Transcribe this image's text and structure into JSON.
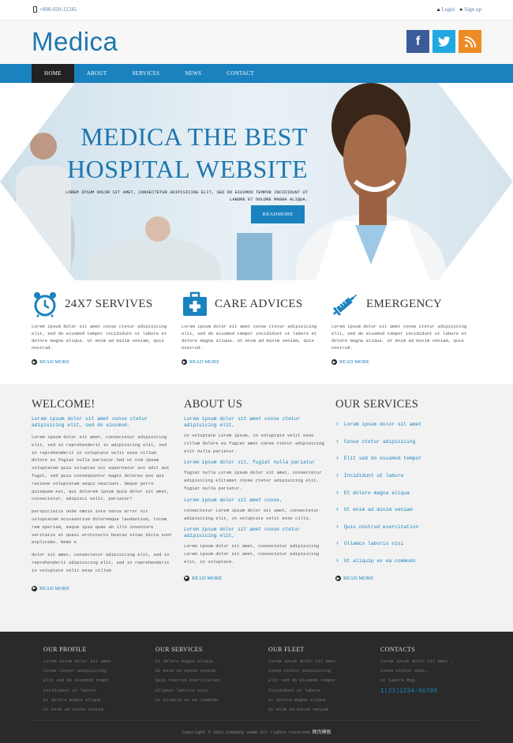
{
  "topbar": {
    "phone": "+800-020-12345",
    "login": "Login",
    "signup": "Sign up"
  },
  "header": {
    "logo": "Medica"
  },
  "social": {
    "facebook": "f",
    "twitter": "t",
    "rss": "rss"
  },
  "nav": {
    "items": [
      "HOME",
      "ABOUT",
      "SERVICES",
      "NEWS",
      "CONTACT"
    ]
  },
  "hero": {
    "title_line1": "MEDICA THE BEST",
    "title_line2": "HOSPITAL WEBSITE",
    "subtitle": "LOREM IPSUM DOLOR SIT AMET, CONSECTETUR ADIPISICING ELIT, SED DO EIUSMOD TEMPOR INCIDIDUNT UT LABORE ET DOLORE MAGNA ALIQUA.",
    "button": "READMORE"
  },
  "features": [
    {
      "title": "24X7 SERVIVES",
      "text": "Lorem ipsum dolor sit amet conse ctetur adipisicing elit, sed do eiusmod tempor incididunt ut labore et dolore magna aliqua. Ut enim ad minim veniam, quis nostrud.",
      "readmore": "READ MORE"
    },
    {
      "title": "CARE ADVICES",
      "text": "Lorem ipsum dolor sit amet conse ctetur adipisicing elit, sed do eiusmod tempor incididunt ut labore et dolore magna aliqua. Ut enim ad minim veniam, quis nostrud.",
      "readmore": "READ MORE"
    },
    {
      "title": "EMERGENCY",
      "text": "Lorem ipsum dolor sit amet conse ctetur adipisicing elit, sed do eiusmod tempor incididunt ut labore et dolore magna aliqua. Ut enim ad minim veniam, quis nostrud.",
      "readmore": "READ MORE"
    }
  ],
  "welcome": {
    "title": "WELCOME!",
    "head": "Lorem ipsum dolor sit amet conse ctetur adipisicing elit, sed do eiusmod.",
    "para1": "Lorem ipsum dolor sit amet, consectetur adipisicing elit, sed in reprehenderit in adipisicing elit, sed in reprehenderit in voluptate velit esse cillum dolore eu fugiat nulla pariatur.Sed ut nim ipsam voluptatem quia voluptas sit aspernatur aut odit aut fugit, sed quia consequuntur magni dolores eos qui ratione voluptatem sequi nesciunt. Neque porro quisquam est, qui dolorem ipsum quia dolor sit amet, consectetur, adipisci velit, pariatur?",
    "para2": "perspiciatis unde omnis iste natus error sit voluptatem accusantium doloremque laudantium, totam rem aperiam, eaque ipsa quae ab illo inventore veritatis et quasi architecto beatae vitae dicta sunt explicabo. Nemo e",
    "para3": "dolor sit amet, consectetur adipisicing elit, sed in reprehenderit adipisicing elit, sed in reprehenderit in voluptate velit esse cillum",
    "readmore": "READ MORE"
  },
  "about": {
    "title": "ABOUT US",
    "blocks": [
      {
        "head": "Lorem ipsum dolor sit amet conse ctetur adipisicing elit,",
        "text": "in voluptate Lorem ipsum, in voluptate velit esse cillum dolore eu fugiat amet conse ctetur adipisicing elit nulla pariatur."
      },
      {
        "head": "Lorem ipsum dolor sit, fugiat nulla pariatur",
        "text": "fugiat nulla Lorem ipsum dolor sit amet, consectetur adipisicing elitamet conse ctetur adipisicing elit, fugiat nulla pariatur."
      },
      {
        "head": "Lorem ipsum dolor sit amet conse,",
        "text": "consectetur Lorem ipsum dolor sit amet, consectetur adipisicing elit, in voluptate velit esse cillu."
      },
      {
        "head": "Lorem ipsum dolor sit amet conse ctetur adipisicing elit,",
        "text": "Lorem ipsum dolor sit amet, consectetur adipisicing Lorem ipsum dolor sit amet, consectetur adipisicing elit, in voluptate."
      }
    ],
    "readmore": "READ MORE"
  },
  "services": {
    "title": "OUR SERVICES",
    "items": [
      "Lorem ipsum dolor sit amet",
      "Conse ctetur adipisicing",
      "Elit sed do eiusmod tempor",
      "Incididunt ut labore",
      "Et dolore magna aliqua",
      "Ut enim ad minim veniam",
      "Quis nostrud exercitation",
      "Ullamco laboris nisi",
      "Ut aliquip ex ea commodo"
    ],
    "readmore": "READ MORE"
  },
  "footer": {
    "profile": {
      "title": "OUR PROFILE",
      "items": [
        "Lorem ipsum dolor sit amet",
        "Conse ctetur adipisicing",
        "Elit sed do eiusmod tempo",
        "Incididunt ut labore",
        "Et dolore magna aliqua",
        "Ut enim ad minim veniam"
      ]
    },
    "services": {
      "title": "OUR SERVICES",
      "items": [
        "Et dolore magna aliqua",
        "Ut enim ad minim veniam",
        "Quis nostrud exercitation",
        "Ullamco laboris nisi",
        "Ut aliquip ex ea commodo"
      ]
    },
    "fleet": {
      "title": "OUR FLEET",
      "items": [
        "Lorem ipsum dolor sit amet",
        "Conse ctetur adipisicing",
        "Elit sed do eiusmod tempor",
        "Incididunt ut labore",
        "Et dolore magna aliqua",
        "Ut enim ad minim veniam"
      ]
    },
    "contacts": {
      "title": "CONTACTS",
      "items": [
        "Lorem ipsum dolor sit amet ,",
        "Conse ctetur adip..",
        "ut labore Mag."
      ],
      "phone": "1(23)1234-56789"
    },
    "copyright": "Copyright © 2013.Company name All rights reserved.",
    "copyright_brand": "网页模板"
  },
  "colors": {
    "brand_blue": "#1a82bf",
    "nav_active": "#222222",
    "footer_bg": "#2a2a2a"
  }
}
